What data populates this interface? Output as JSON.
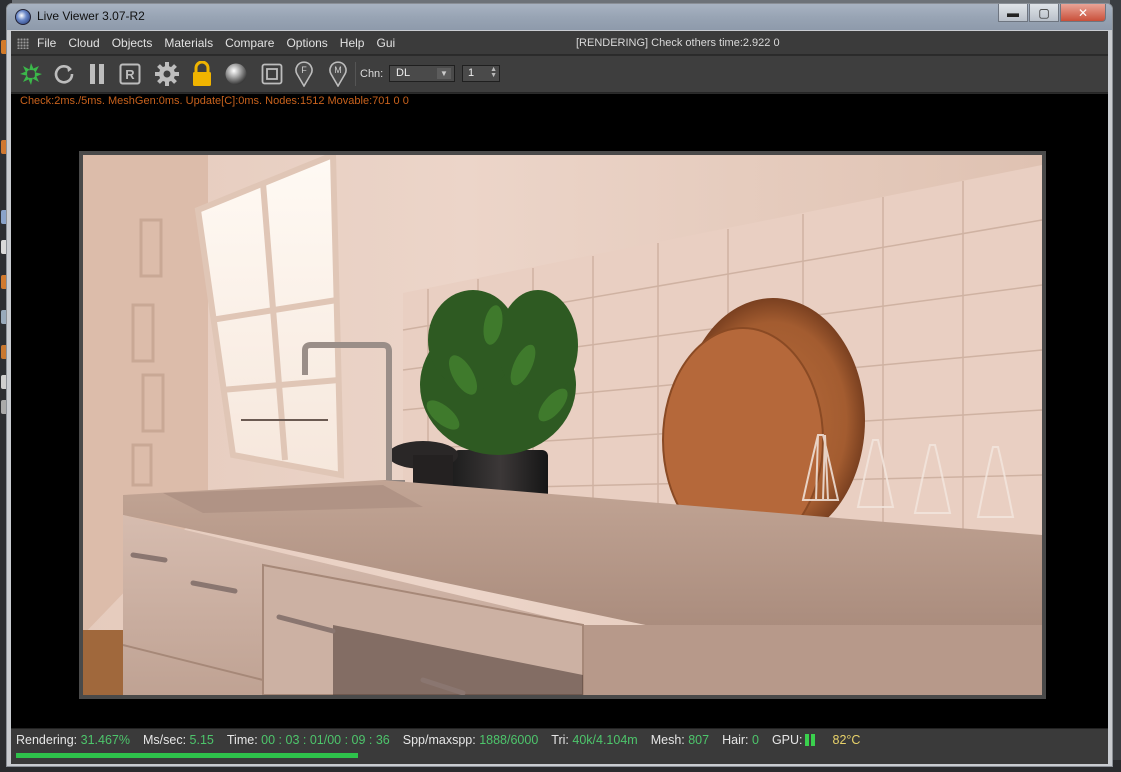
{
  "window": {
    "title": "Live Viewer 3.07-R2",
    "buttons": {
      "minimize": "▬",
      "maximize": "▢",
      "close": "✕"
    }
  },
  "menu": {
    "items": [
      "File",
      "Cloud",
      "Objects",
      "Materials",
      "Compare",
      "Options",
      "Help",
      "Gui"
    ],
    "status": "[RENDERING] Check others time:2.922  0"
  },
  "toolbar": {
    "icons": [
      "start-render-icon",
      "restart-icon",
      "pause-icon",
      "region-render-icon",
      "settings-gear-icon",
      "lock-icon",
      "material-ball-icon",
      "region-box-icon",
      "pin-f-icon",
      "pin-m-icon"
    ],
    "pin_f": "F",
    "pin_m": "M",
    "region_letter": "R",
    "channel_label": "Chn:",
    "channel_value": "DL",
    "number_value": "1"
  },
  "viewport": {
    "stats": "Check:2ms./5ms. MeshGen:0ms. Update[C]:0ms. Nodes:1512 Movable:701  0 0",
    "image": "kitchen-counter-render"
  },
  "status": {
    "rendering_label": "Rendering:",
    "rendering_value": "31.467%",
    "mssec_label": "Ms/sec:",
    "mssec_value": "5.15",
    "time_label": "Time:",
    "time_value": "00 : 03 : 01/00 : 09 : 36",
    "spp_label": "Spp/maxspp:",
    "spp_value": "1888/6000",
    "tri_label": "Tri:",
    "tri_value": "40k/4.104m",
    "mesh_label": "Mesh:",
    "mesh_value": "807",
    "hair_label": "Hair:",
    "hair_value": "0",
    "gpu_label": "GPU:",
    "temp_value": "82°C",
    "progress": 0.31467
  },
  "colors": {
    "accent_green": "#2ec24b",
    "stats_orange": "#c8621d",
    "lock_yellow": "#f0b400",
    "temp_yellow": "#e8d26a"
  }
}
